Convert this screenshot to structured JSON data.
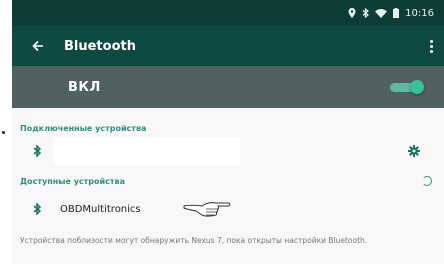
{
  "status": {
    "time": "10:16"
  },
  "appbar": {
    "title": "Bluetooth"
  },
  "switch": {
    "label": "ВКЛ",
    "on": true
  },
  "paired": {
    "header": "Подключенные устройства"
  },
  "available": {
    "header": "Доступные устройства",
    "devices": [
      {
        "name": "OBDMultitronics"
      }
    ]
  },
  "hint": "Устройства поблизости могут обнаружить Nexus 7, пока открыты настройки Bluetooth.",
  "colors": {
    "statusbar": "#0c3d36",
    "appbar": "#0f4a42",
    "switchbar": "#4f6260",
    "accent": "#2f8f7f"
  },
  "icons": [
    "back-arrow-icon",
    "overflow-menu-icon",
    "bluetooth-icon",
    "gear-icon",
    "pointer-hand-icon"
  ]
}
